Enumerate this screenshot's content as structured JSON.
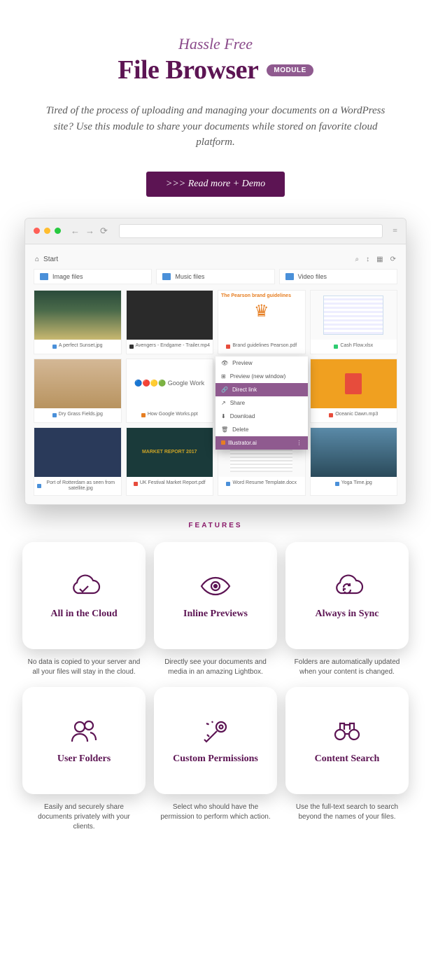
{
  "header": {
    "subtitle": "Hassle Free",
    "title": "File Browser",
    "badge": "MODULE"
  },
  "description": "Tired of the process of uploading and managing your documents on a WordPress site? Use this module to share your documents while stored on favorite cloud platform.",
  "cta": ">>> Read more + Demo",
  "browser": {
    "breadcrumb_start": "Start",
    "folders": [
      "Image files",
      "Music files",
      "Video files"
    ],
    "files": [
      {
        "name": "A perfect Sunset.jpg",
        "type": "img"
      },
      {
        "name": "Avengers - Endgame - Trailer.mp4",
        "type": "vid"
      },
      {
        "name": "Brand guidelines Pearson.pdf",
        "type": "pdf",
        "thumb_text": "The Pearson brand guidelines"
      },
      {
        "name": "Cash Flow.xlsx",
        "type": "xls"
      },
      {
        "name": "Dry Grass Fields.jpg",
        "type": "img"
      },
      {
        "name": "How Google Works.ppt",
        "type": "ppt",
        "thumb_text": "Google Work"
      },
      {
        "name": "Illustrator.ai",
        "type": "ai"
      },
      {
        "name": "Oceanic Dawn.mp3",
        "type": "mp3"
      },
      {
        "name": "Port of Rotterdam as seen from satellite.jpg",
        "type": "img"
      },
      {
        "name": "UK Festival Market Report.pdf",
        "type": "pdf",
        "thumb_text": "MARKET REPORT 2017"
      },
      {
        "name": "Word Resume Template.docx",
        "type": "doc"
      },
      {
        "name": "Yoga Time.jpg",
        "type": "img"
      }
    ],
    "context_menu": {
      "items": [
        "Preview",
        "Preview (new window)",
        "Direct link",
        "Share",
        "Download",
        "Delete"
      ],
      "active_index": 2,
      "footer_file": "Illustrator.ai"
    }
  },
  "features_label": "FEATURES",
  "features": [
    {
      "title": "All in the Cloud",
      "desc": "No data is copied to your server and all your files will stay in the cloud."
    },
    {
      "title": "Inline Previews",
      "desc": "Directly see your documents and media in an amazing Lightbox."
    },
    {
      "title": "Always in Sync",
      "desc": "Folders are automatically updated when your content is changed."
    },
    {
      "title": "User Folders",
      "desc": "Easily and securely share documents privately with your clients."
    },
    {
      "title": "Custom Permissions",
      "desc": "Select who should have the permission to perform which action."
    },
    {
      "title": "Content Search",
      "desc": "Use the full-text search to search beyond the names of your files."
    }
  ]
}
